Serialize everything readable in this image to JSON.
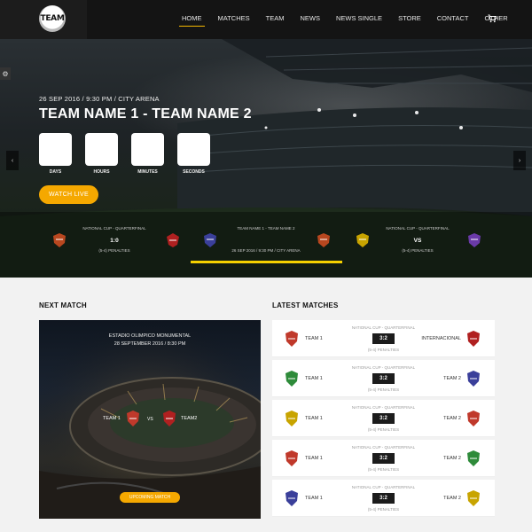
{
  "header": {
    "logo_text": "TEAM",
    "nav": [
      "HOME",
      "MATCHES",
      "TEAM",
      "NEWS",
      "NEWS SINGLE",
      "STORE",
      "CONTACT",
      "OTHER"
    ],
    "active": "HOME",
    "cart_icon": "cart-icon"
  },
  "hero": {
    "date_line": "26 SEP 2016 / 9:30 PM / CITY ARENA",
    "title": "TEAM NAME 1 - TEAM NAME 2",
    "countdown_labels": [
      "DAYS",
      "HOURS",
      "MINUTES",
      "SECONDS"
    ],
    "watch_button": "WATCH LIVE",
    "matches": [
      {
        "competition": "NATIONAL CUP - QUARTERFINAL",
        "score": "1:0",
        "subtitle": "(5-4) PENALTIES",
        "home_crest": "PANTHERS",
        "away_crest": "BROWNS"
      },
      {
        "competition": "TEAM NAME 1 - TEAM NAME 2",
        "score": "",
        "subtitle": "26 SEP 2016 / 9:30 PM / CITY ARENA",
        "home_crest": "WOLVES",
        "away_crest": "PANTHERS"
      },
      {
        "competition": "NATIONAL CUP - QUARTERFINAL",
        "score": "VS",
        "subtitle": "(5-4) PENALTIES",
        "home_crest": "EAGLES",
        "away_crest": "KNIGHTS"
      }
    ]
  },
  "next_match": {
    "heading": "NEXT MATCH",
    "venue": "ESTADIO OLIMPICO MONUMENTAL",
    "datetime": "28 SEPTEMBER 2016 / 8:30 PM",
    "team1": "TEAM 1",
    "team2": "TEAM2",
    "vs": "VS",
    "button": "UPCOMING MATCH"
  },
  "latest_matches": {
    "heading": "LATEST MATCHES",
    "rows": [
      {
        "competition": "NATIONAL CUP - QUARTERFINAL",
        "home": "TEAM 1",
        "away": "INTERNACIONAL",
        "score": "3:2",
        "penalties": "(5-4) PENALTIES",
        "home_color": "#c0392b",
        "away_color": "#b02020"
      },
      {
        "competition": "NATIONAL CUP - QUARTERFINAL",
        "home": "TEAM 1",
        "away": "TEAM 2",
        "score": "3:2",
        "penalties": "(5-4) PENALTIES",
        "home_color": "#2e8b3a",
        "away_color": "#3a3f9a"
      },
      {
        "competition": "NATIONAL CUP - QUARTERFINAL",
        "home": "TEAM 1",
        "away": "TEAM 2",
        "score": "3:2",
        "penalties": "(5-4) PENALTIES",
        "home_color": "#c8a400",
        "away_color": "#c0392b"
      },
      {
        "competition": "NATIONAL CUP - QUARTERFINAL",
        "home": "TEAM 1",
        "away": "TEAM 2",
        "score": "3:2",
        "penalties": "(5-4) PENALTIES",
        "home_color": "#c0392b",
        "away_color": "#2e8b3a"
      },
      {
        "competition": "NATIONAL CUP - QUARTERFINAL",
        "home": "TEAM 1",
        "away": "TEAM 2",
        "score": "3:2",
        "penalties": "(5-4) PENALTIES",
        "home_color": "#3a3f9a",
        "away_color": "#c8a400"
      }
    ]
  }
}
